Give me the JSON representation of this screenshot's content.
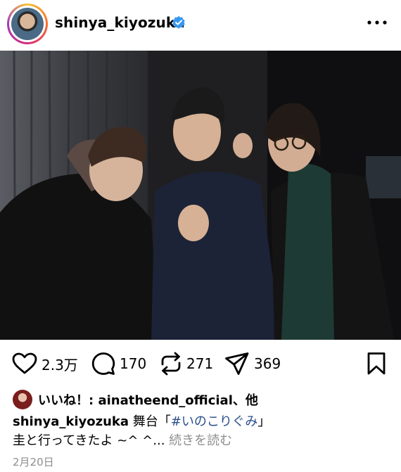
{
  "header": {
    "username": "shinya_kiyozuka",
    "verified": true,
    "avatar_icon": "profile-avatar",
    "more_icon": "more-horizontal-icon"
  },
  "post": {
    "image_icon": "photo-three-men-backstage"
  },
  "actions": {
    "like_count": "2.3万",
    "comment_count": "170",
    "repost_count": "271",
    "share_count": "369",
    "icons": [
      "heart-icon",
      "comment-icon",
      "repost-icon",
      "share-icon",
      "bookmark-icon"
    ]
  },
  "likes": {
    "prefix": "いいね！: ",
    "user": "ainatheend_official",
    "suffix": "、他"
  },
  "caption": {
    "username": "shinya_kiyozuka",
    "text_before": " 舞台「",
    "hashtag": "#いのこりぐみ",
    "text_after": "」",
    "line2": "圭と行ってきたよ ~^ ^...",
    "more_label": " 続きを読む"
  },
  "date": "2月20日",
  "colors": {
    "link": "#2b4f8c",
    "muted": "#8e8e8e",
    "verified": "#3897f0"
  }
}
